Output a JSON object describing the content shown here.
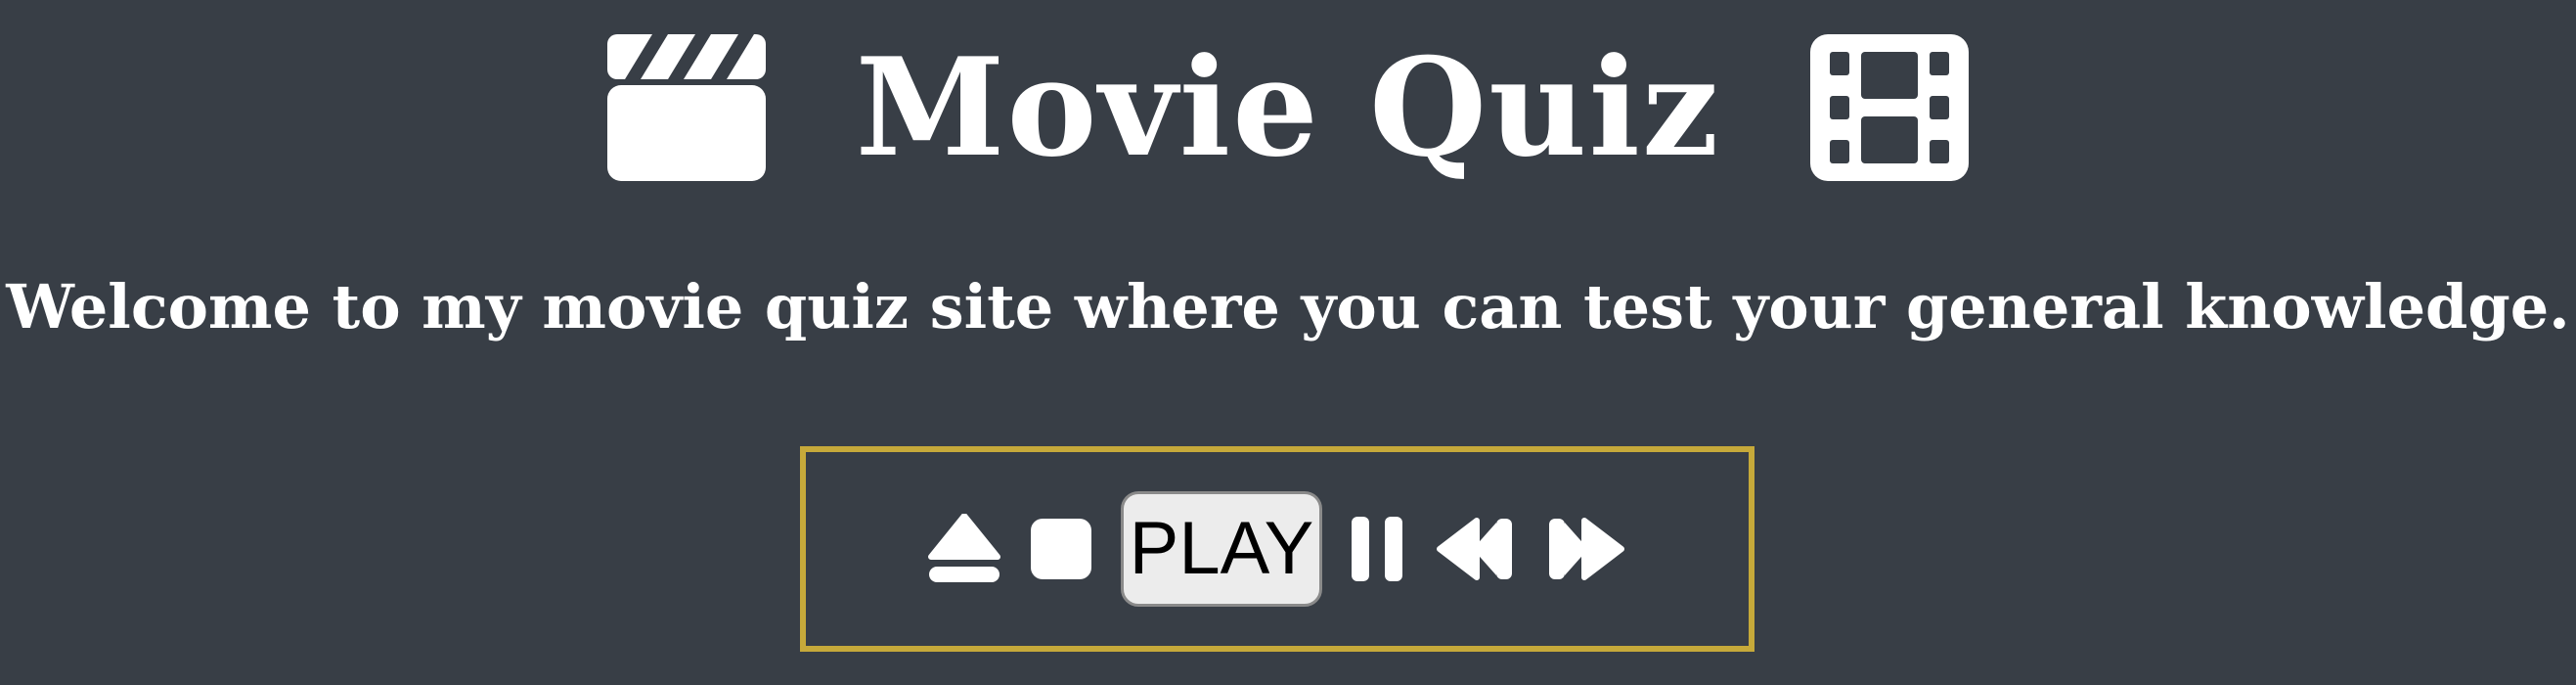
{
  "header": {
    "title": "Movie Quiz",
    "left_icon": "clapperboard-icon",
    "right_icon": "film-icon"
  },
  "intro": {
    "text": "Welcome to my movie quiz site where you can test your general knowledge."
  },
  "controls": {
    "icons": [
      "eject-icon",
      "stop-icon",
      "pause-icon",
      "backward-icon",
      "forward-icon"
    ],
    "play_label": "PLAY"
  },
  "colors": {
    "background": "#383e46",
    "text": "#ffffff",
    "frame_border": "#c6a93a",
    "play_button_bg": "#ececec"
  }
}
